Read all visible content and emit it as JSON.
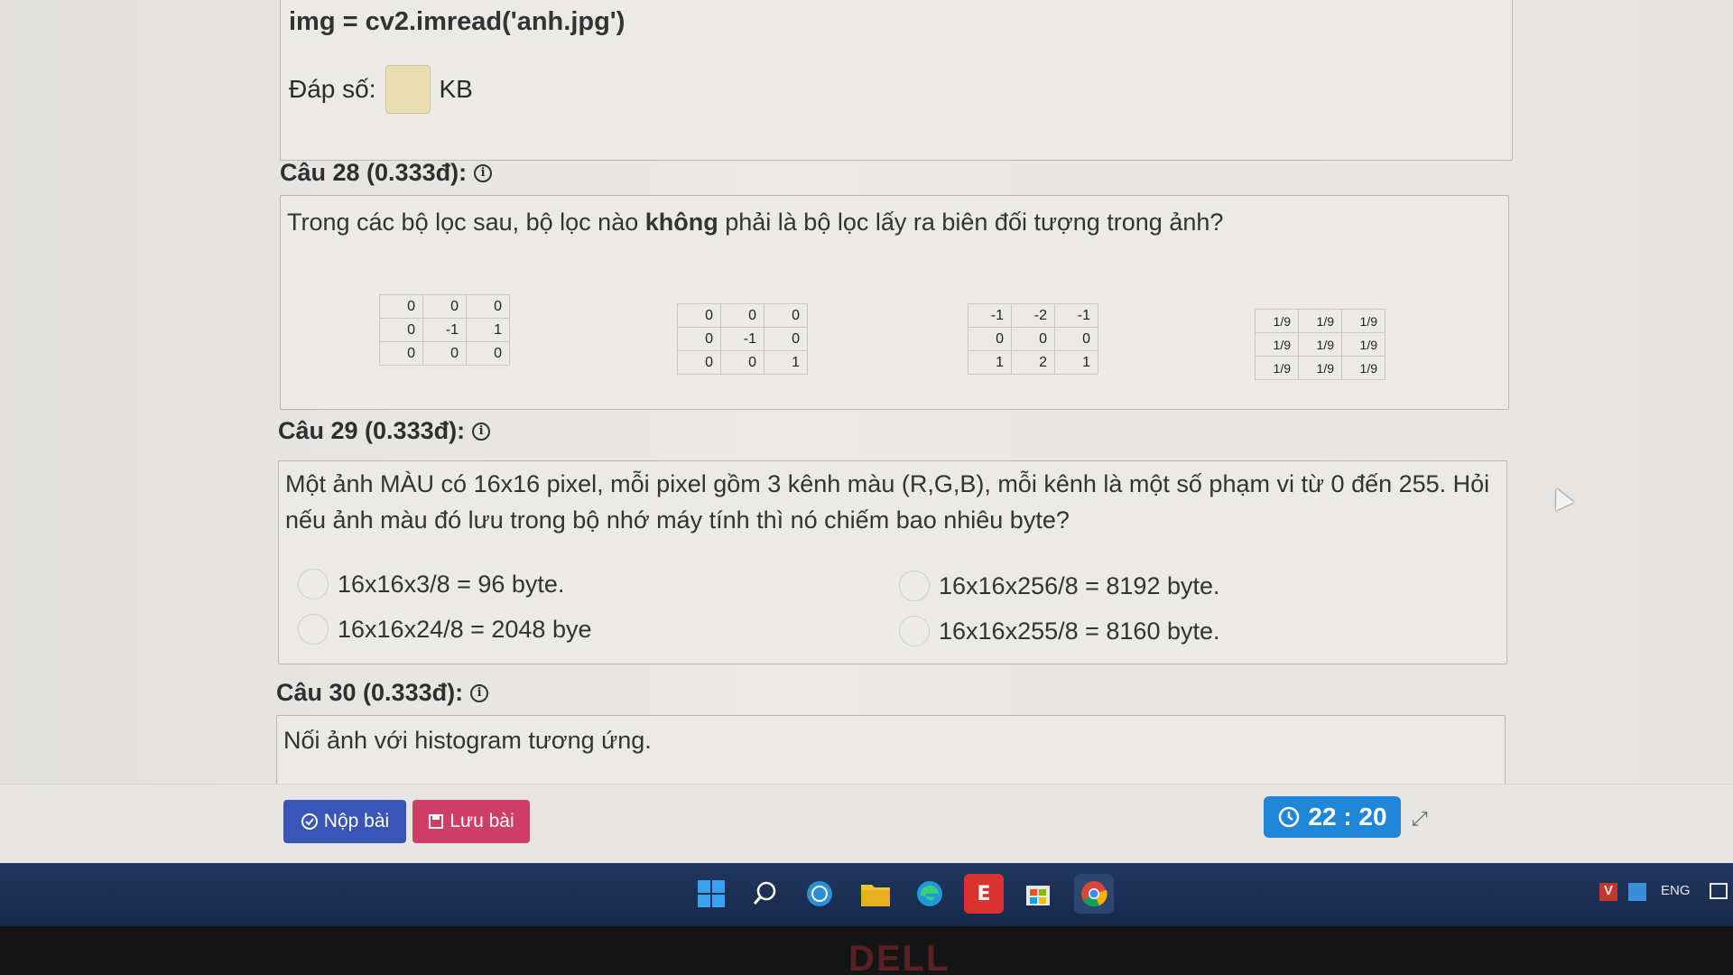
{
  "q27": {
    "code": "img = cv2.imread('anh.jpg')",
    "answer_label": "Đáp số:",
    "answer_value": "",
    "unit": "KB"
  },
  "q28": {
    "heading": "Câu 28 (0.333đ):",
    "text_before": "Trong các bộ lọc sau, bộ lọc nào ",
    "text_bold": "không",
    "text_after": " phải là bộ lọc lấy ra biên đối tượng trong ảnh?",
    "filters": [
      [
        [
          "0",
          "0",
          "0"
        ],
        [
          "0",
          "-1",
          "1"
        ],
        [
          "0",
          "0",
          "0"
        ]
      ],
      [
        [
          "0",
          "0",
          "0"
        ],
        [
          "0",
          "-1",
          "0"
        ],
        [
          "0",
          "0",
          "1"
        ]
      ],
      [
        [
          "-1",
          "-2",
          "-1"
        ],
        [
          "0",
          "0",
          "0"
        ],
        [
          "1",
          "2",
          "1"
        ]
      ],
      [
        [
          "1/9",
          "1/9",
          "1/9"
        ],
        [
          "1/9",
          "1/9",
          "1/9"
        ],
        [
          "1/9",
          "1/9",
          "1/9"
        ]
      ]
    ]
  },
  "q29": {
    "heading": "Câu 29 (0.333đ):",
    "text": "Một ảnh MÀU có 16x16 pixel, mỗi pixel gồm 3 kênh màu (R,G,B), mỗi kênh là một số phạm vi từ 0 đến 255. Hỏi nếu ảnh màu đó lưu trong bộ nhớ máy tính thì nó chiếm bao nhiêu byte?",
    "options": [
      "16x16x3/8 = 96 byte.",
      "16x16x256/8 = 8192 byte.",
      "16x16x24/8 = 2048 bye",
      "16x16x255/8 = 8160 byte."
    ]
  },
  "q30": {
    "heading": "Câu 30 (0.333đ):",
    "text": "Nối ảnh với histogram tương ứng."
  },
  "footer": {
    "submit_label": "Nộp bài",
    "save_label": "Lưu bài",
    "timer": "22 : 20"
  },
  "taskbar": {
    "lang": "ENG"
  },
  "brand": "DELL",
  "colors": {
    "submit": "#3a55b8",
    "save": "#cf3e66",
    "timer": "#1f86d8",
    "taskbar": "#1f3760"
  }
}
